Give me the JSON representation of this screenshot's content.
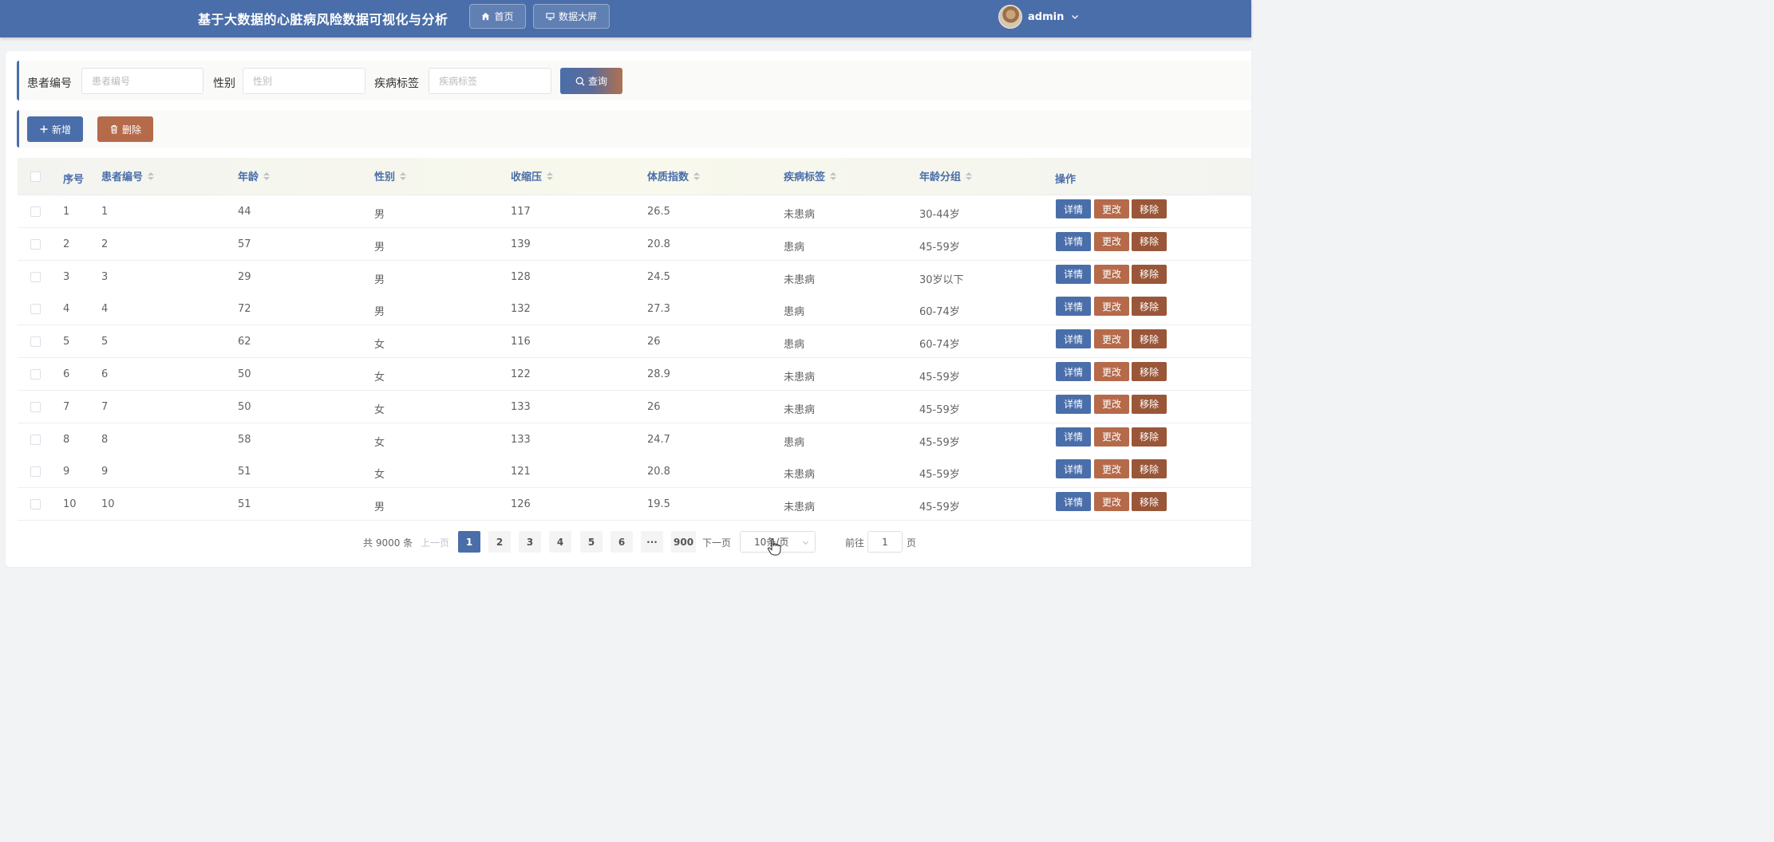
{
  "header": {
    "title": "基于大数据的心脏病风险数据可视化与分析",
    "nav": [
      {
        "label": "首页",
        "icon": "home-icon"
      },
      {
        "label": "数据大屏",
        "icon": "dashboard-icon"
      }
    ],
    "user": {
      "name": "admin"
    }
  },
  "search": {
    "fields": [
      {
        "label": "患者编号",
        "placeholder": "患者编号",
        "value": ""
      },
      {
        "label": "性别",
        "placeholder": "性别",
        "value": ""
      },
      {
        "label": "疾病标签",
        "placeholder": "疾病标签",
        "value": ""
      }
    ],
    "query_label": "查询"
  },
  "actions": {
    "add_label": "新增",
    "delete_label": "删除"
  },
  "table": {
    "columns": [
      "序号",
      "患者编号",
      "年龄",
      "性别",
      "收缩压",
      "体质指数",
      "疾病标签",
      "年龄分组",
      "操作"
    ],
    "sortable": [
      false,
      true,
      true,
      true,
      true,
      true,
      true,
      true,
      false
    ],
    "rows": [
      [
        "1",
        "1",
        "44",
        "男",
        "117",
        "26.5",
        "未患病",
        "30-44岁"
      ],
      [
        "2",
        "2",
        "57",
        "男",
        "139",
        "20.8",
        "患病",
        "45-59岁"
      ],
      [
        "3",
        "3",
        "29",
        "男",
        "128",
        "24.5",
        "未患病",
        "30岁以下"
      ],
      [
        "4",
        "4",
        "72",
        "男",
        "132",
        "27.3",
        "患病",
        "60-74岁"
      ],
      [
        "5",
        "5",
        "62",
        "女",
        "116",
        "26",
        "患病",
        "60-74岁"
      ],
      [
        "6",
        "6",
        "50",
        "女",
        "122",
        "28.9",
        "未患病",
        "45-59岁"
      ],
      [
        "7",
        "7",
        "50",
        "女",
        "133",
        "26",
        "未患病",
        "45-59岁"
      ],
      [
        "8",
        "8",
        "58",
        "女",
        "133",
        "24.7",
        "患病",
        "45-59岁"
      ],
      [
        "9",
        "9",
        "51",
        "女",
        "121",
        "20.8",
        "未患病",
        "45-59岁"
      ],
      [
        "10",
        "10",
        "51",
        "男",
        "126",
        "19.5",
        "未患病",
        "45-59岁"
      ]
    ],
    "row_actions": {
      "detail": "详情",
      "edit": "更改",
      "remove": "移除"
    }
  },
  "pagination": {
    "total_text": "共 9000 条",
    "prev": "上一页",
    "next": "下一页",
    "pages": [
      "1",
      "2",
      "3",
      "4",
      "5",
      "6",
      "···",
      "900"
    ],
    "current_page": "1",
    "page_size": "10条/页",
    "goto_prefix": "前往",
    "goto_value": "1",
    "goto_suffix": "页"
  },
  "colors": {
    "primary": "#4a6ea9",
    "edit": "#b56a4a",
    "remove": "#9a5638"
  }
}
